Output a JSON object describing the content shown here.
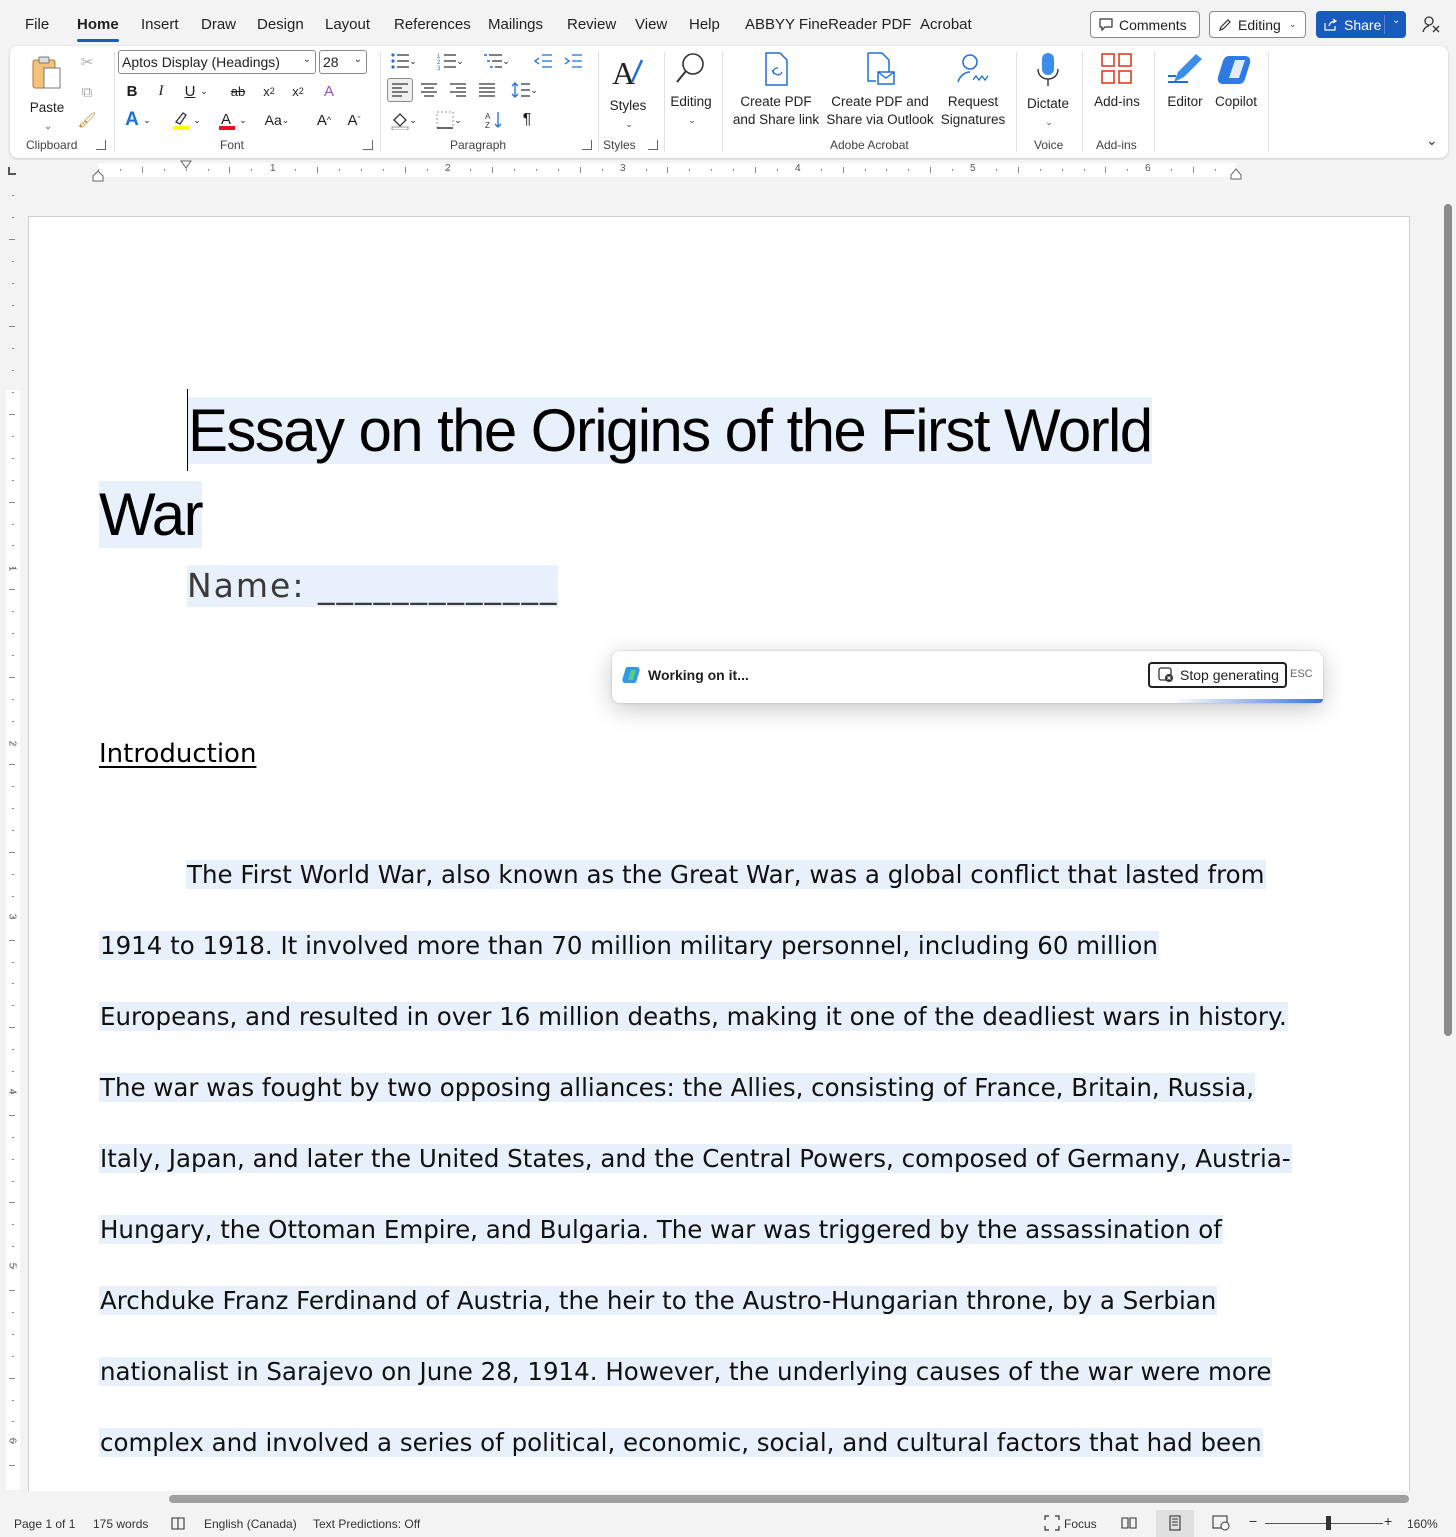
{
  "menu": {
    "tabs": [
      "File",
      "Home",
      "Insert",
      "Draw",
      "Design",
      "Layout",
      "References",
      "Mailings",
      "Review",
      "View",
      "Help",
      "ABBYY FineReader PDF",
      "Acrobat"
    ],
    "active_tab": "Home",
    "comments_label": "Comments",
    "editing_label": "Editing",
    "share_label": "Share"
  },
  "ribbon": {
    "clipboard": {
      "paste_label": "Paste",
      "group_label": "Clipboard"
    },
    "font": {
      "font_name": "Aptos Display (Headings)",
      "font_size": "28",
      "group_label": "Font",
      "highlight_color": "#ffff00",
      "font_color": "#e81123"
    },
    "paragraph": {
      "group_label": "Paragraph"
    },
    "styles": {
      "styles_label": "Styles",
      "group_label": "Styles"
    },
    "editing": {
      "label": "Editing"
    },
    "adobe": {
      "create_pdf_share_link": [
        "Create PDF",
        "and Share link"
      ],
      "create_pdf_outlook": [
        "Create PDF and",
        "Share via Outlook"
      ],
      "request_signatures": [
        "Request",
        "Signatures"
      ],
      "group_label": "Adobe Acrobat"
    },
    "voice": {
      "dictate_label": "Dictate",
      "group_label": "Voice"
    },
    "addins": {
      "addins_label": "Add-ins",
      "group_label": "Add-ins"
    },
    "editor_label": "Editor",
    "copilot_label": "Copilot"
  },
  "ruler": {
    "h_numbers": [
      "1",
      "2",
      "3",
      "4",
      "5",
      "6"
    ],
    "v_numbers": [
      "1",
      "2",
      "3",
      "4",
      "5",
      "6"
    ]
  },
  "document": {
    "title_line1": "Essay on the Origins of the First World",
    "title_line2": "War",
    "name_line": "Name: _____________",
    "intro_heading": "Introduction",
    "body_lines": [
      "The First World War, also known as the Great War, was a global conflict that lasted from",
      "1914 to 1918. It involved more than 70 million military personnel, including 60 million",
      "Europeans, and resulted in over 16 million deaths, making it one of the deadliest wars in history.",
      "The war was fought by two opposing alliances: the Allies, consisting of France, Britain, Russia,",
      "Italy, Japan, and later the United States, and the Central Powers, composed of Germany, Austria-",
      "Hungary, the Ottoman Empire, and Bulgaria. The war was triggered by the assassination of",
      "Archduke Franz Ferdinand of Austria, the heir to the Austro-Hungarian throne, by a Serbian",
      "nationalist in Sarajevo on June 28, 1914. However, the underlying causes of the war were more",
      "complex and involved a series of political, economic, social, and cultural factors that had been"
    ]
  },
  "copilot_popup": {
    "status": "Working on it...",
    "stop_label": "Stop generating",
    "esc_label": "ESC"
  },
  "statusbar": {
    "page": "Page 1 of 1",
    "words": "175 words",
    "language": "English (Canada)",
    "predictions": "Text Predictions: Off",
    "focus": "Focus",
    "zoom": "160%",
    "zoom_minus": "−",
    "zoom_plus": "+"
  },
  "colors": {
    "accent": "#185abd",
    "selection": "#e8f1fb"
  }
}
